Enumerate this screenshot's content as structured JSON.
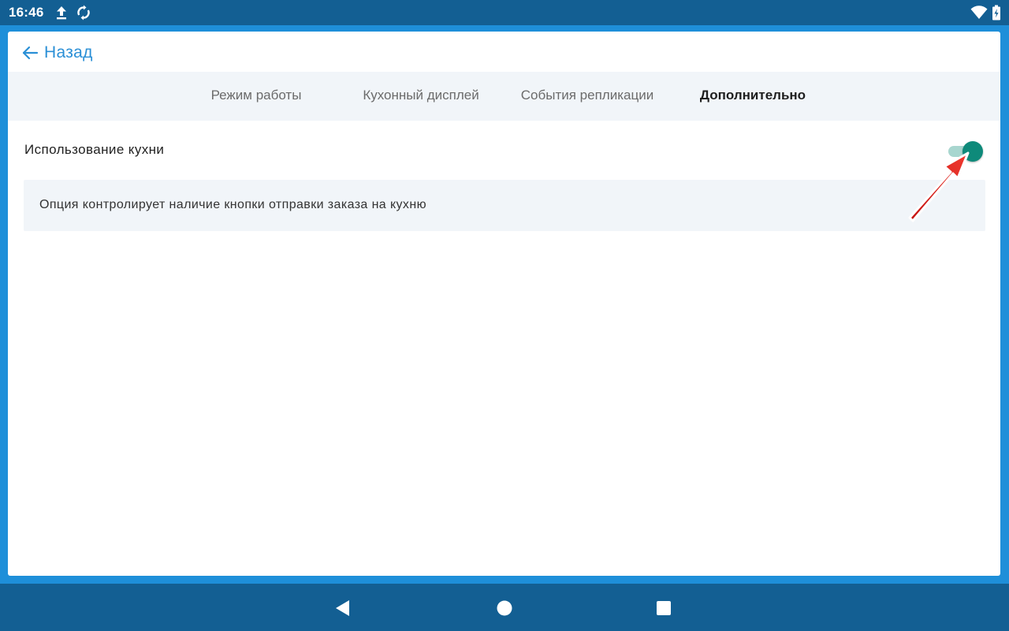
{
  "status_bar": {
    "time": "16:46",
    "left_icons": [
      "upload-icon",
      "sync-icon"
    ],
    "right_icons": [
      "wifi-icon",
      "battery-charging-icon"
    ]
  },
  "header": {
    "back_label": "Назад",
    "back_icon": "arrow-left-icon"
  },
  "tabs": [
    {
      "label": "Режим работы",
      "active": false
    },
    {
      "label": "Кухонный дисплей",
      "active": false
    },
    {
      "label": "События репликации",
      "active": false
    },
    {
      "label": "Дополнительно",
      "active": true
    }
  ],
  "settings": {
    "kitchen_usage": {
      "label": "Использование кухни",
      "enabled": true,
      "description": "Опция контролирует наличие кнопки отправки заказа на кухню"
    }
  },
  "nav_bar": {
    "icons": [
      "back-triangle-icon",
      "home-circle-icon",
      "recents-square-icon"
    ]
  },
  "colors": {
    "status_bar": "#135f93",
    "frame": "#1e8fd9",
    "accent": "#2a8fd6",
    "toggle_on": "#0e8a7a",
    "annotation_arrow": "#e8201e"
  }
}
